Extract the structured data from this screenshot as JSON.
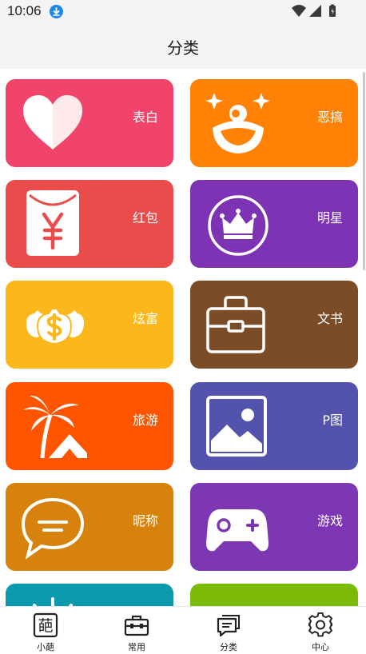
{
  "status_bar": {
    "time": "10:06",
    "icons": [
      "download-icon",
      "wifi-icon",
      "signal-icon",
      "battery-icon"
    ]
  },
  "header": {
    "title": "分类"
  },
  "categories": [
    {
      "label": "表白",
      "icon": "heart-icon",
      "color": "#f0446a"
    },
    {
      "label": "恶搞",
      "icon": "clown-face-icon",
      "color": "#ff8207"
    },
    {
      "label": "红包",
      "icon": "red-envelope-icon",
      "color": "#ea4c4c"
    },
    {
      "label": "明星",
      "icon": "crown-icon",
      "color": "#7d33b3"
    },
    {
      "label": "炫富",
      "icon": "money-bags-icon",
      "color": "#fcb71b"
    },
    {
      "label": "文书",
      "icon": "briefcase-icon",
      "color": "#7a4c28"
    },
    {
      "label": "旅游",
      "icon": "palm-tree-icon",
      "color": "#ff5400"
    },
    {
      "label": "P图",
      "icon": "image-icon",
      "color": "#5353ad"
    },
    {
      "label": "昵称",
      "icon": "speech-bubble-icon",
      "color": "#d6820c"
    },
    {
      "label": "游戏",
      "icon": "gamepad-icon",
      "color": "#7d37b5"
    },
    {
      "icon": "sun-icon",
      "color": "#0b9aad"
    },
    {
      "icon": "leaf-icon",
      "color": "#7bba06"
    }
  ],
  "bottom_nav": [
    {
      "label": "小葩",
      "icon": "flower-char-icon"
    },
    {
      "label": "常用",
      "icon": "toolbox-icon"
    },
    {
      "label": "分类",
      "icon": "chat-list-icon"
    },
    {
      "label": "中心",
      "icon": "gear-icon"
    }
  ]
}
